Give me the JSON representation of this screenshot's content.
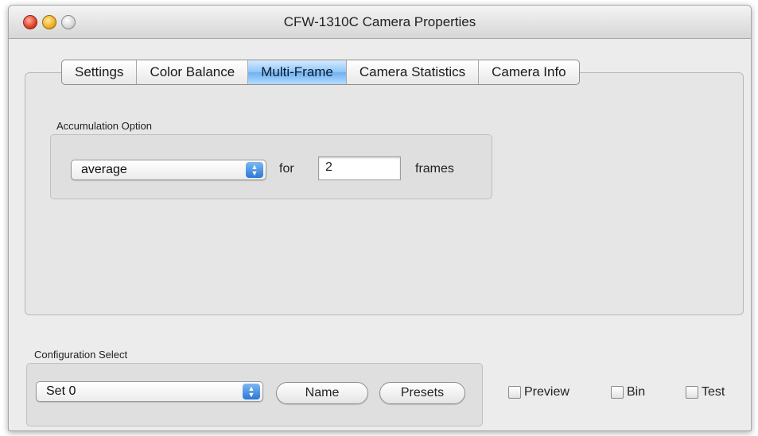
{
  "window": {
    "title": "CFW-1310C Camera Properties"
  },
  "tabs": [
    {
      "label": "Settings",
      "selected": false
    },
    {
      "label": "Color Balance",
      "selected": false
    },
    {
      "label": "Multi-Frame",
      "selected": true
    },
    {
      "label": "Camera Statistics",
      "selected": false
    },
    {
      "label": "Camera Info",
      "selected": false
    }
  ],
  "accumulation": {
    "group_label": "Accumulation Option",
    "mode_value": "average",
    "for_label": "for",
    "frames_value": "2",
    "frames_label": "frames"
  },
  "configuration": {
    "group_label": "Configuration Select",
    "set_value": "Set 0",
    "name_button": "Name",
    "presets_button": "Presets"
  },
  "checkboxes": {
    "preview": {
      "label": "Preview",
      "checked": false
    },
    "bin": {
      "label": "Bin",
      "checked": false
    },
    "test": {
      "label": "Test",
      "checked": false
    }
  },
  "colors": {
    "selected_tab": "#8fc4f6",
    "popup_arrow": "#2c78d6",
    "close_button": "#e0402a",
    "minimize_button": "#f0b020"
  },
  "icons": {
    "popup_arrows": "updown-arrows-icon"
  }
}
